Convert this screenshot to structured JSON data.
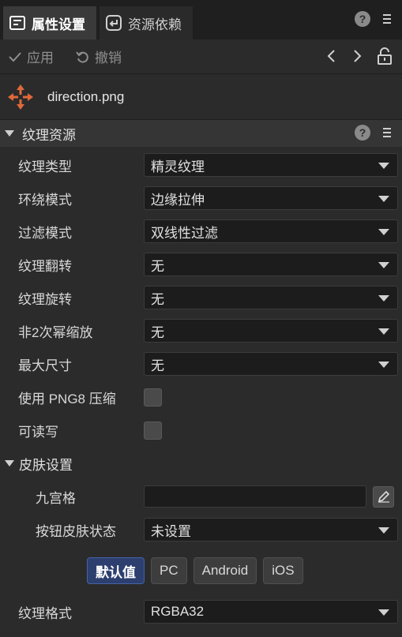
{
  "tabs": [
    {
      "label": "属性设置",
      "icon": "properties-icon",
      "active": true
    },
    {
      "label": "资源依赖",
      "icon": "dependency-icon",
      "active": false
    }
  ],
  "header_icons": {
    "help": "?",
    "menu": "menu-icon"
  },
  "toolbar": {
    "apply_label": "应用",
    "revert_label": "撤销"
  },
  "file": {
    "name": "direction.png",
    "icon": "move-arrows-icon",
    "icon_color": "#e0693a"
  },
  "section": {
    "title": "纹理资源"
  },
  "properties": [
    {
      "label": "纹理类型",
      "value": "精灵纹理"
    },
    {
      "label": "环绕模式",
      "value": "边缘拉伸"
    },
    {
      "label": "过滤模式",
      "value": "双线性过滤"
    },
    {
      "label": "纹理翻转",
      "value": "无"
    },
    {
      "label": "纹理旋转",
      "value": "无"
    },
    {
      "label": "非2次幂缩放",
      "value": "无"
    },
    {
      "label": "最大尺寸",
      "value": "无"
    }
  ],
  "checkboxes": [
    {
      "label": "使用 PNG8 压缩",
      "checked": false
    },
    {
      "label": "可读写",
      "checked": false
    }
  ],
  "skin": {
    "title": "皮肤设置",
    "nine_grid_label": "九宫格",
    "nine_grid_value": "",
    "button_state_label": "按钮皮肤状态",
    "button_state_value": "未设置"
  },
  "platforms": [
    {
      "label": "默认值",
      "active": true
    },
    {
      "label": "PC",
      "active": false
    },
    {
      "label": "Android",
      "active": false
    },
    {
      "label": "iOS",
      "active": false
    }
  ],
  "format": {
    "label": "纹理格式",
    "value": "RGBA32"
  },
  "colors": {
    "accent": "#2c3f6e",
    "background": "#2b2b2b"
  }
}
